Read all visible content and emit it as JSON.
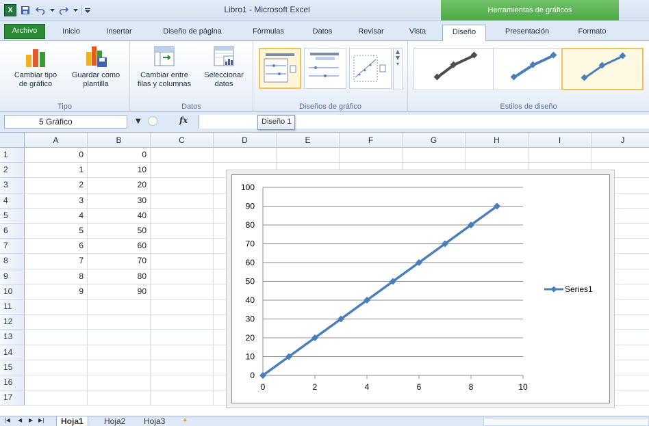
{
  "window": {
    "title": "Libro1 - Microsoft Excel",
    "contextual_header": "Herramientas de gráficos",
    "app_logo": "X"
  },
  "tabs": [
    "Archivo",
    "Inicio",
    "Insertar",
    "Diseño de página",
    "Fórmulas",
    "Datos",
    "Revisar",
    "Vista",
    "Diseño",
    "Presentación",
    "Formato"
  ],
  "active_tab": "Diseño",
  "ribbon": {
    "tipo": {
      "label": "Tipo",
      "change_type": [
        "Cambiar tipo",
        "de gráfico"
      ],
      "save_template": [
        "Guardar como",
        "plantilla"
      ]
    },
    "datos": {
      "label": "Datos",
      "switch": [
        "Cambiar entre",
        "filas y columnas"
      ],
      "select": [
        "Seleccionar",
        "datos"
      ]
    },
    "layouts": {
      "label": "Diseños de gráfico"
    },
    "styles": {
      "label": "Estilos de diseño"
    }
  },
  "formula_bar": {
    "name_box": "5 Gráfico",
    "fx": "fx",
    "value": ""
  },
  "tooltip": "Diseño 1",
  "sheet": {
    "columns": [
      "A",
      "B",
      "C",
      "D",
      "E",
      "F",
      "G",
      "H",
      "I",
      "J"
    ],
    "rows": [
      "1",
      "2",
      "3",
      "4",
      "5",
      "6",
      "7",
      "8",
      "9",
      "10",
      "11",
      "12",
      "13",
      "14",
      "15",
      "16",
      "17"
    ],
    "colA": [
      "0",
      "1",
      "2",
      "3",
      "4",
      "5",
      "6",
      "7",
      "8",
      "9"
    ],
    "colB": [
      "0",
      "10",
      "20",
      "30",
      "40",
      "50",
      "60",
      "70",
      "80",
      "90"
    ]
  },
  "sheet_tabs": [
    "Hoja1",
    "Hoja2",
    "Hoja3"
  ],
  "active_sheet": "Hoja1",
  "colors": {
    "series": "#4a7ebb",
    "file_tab": "#2a8a35",
    "contextual": "#4da845",
    "selection": "#f2c25a"
  },
  "chart_data": {
    "type": "scatter",
    "series": [
      {
        "name": "Series1",
        "x": [
          0,
          1,
          2,
          3,
          4,
          5,
          6,
          7,
          8,
          9
        ],
        "y": [
          0,
          10,
          20,
          30,
          40,
          50,
          60,
          70,
          80,
          90
        ]
      }
    ],
    "xticks": [
      "0",
      "2",
      "4",
      "6",
      "8",
      "10"
    ],
    "yticks": [
      "0",
      "10",
      "20",
      "30",
      "40",
      "50",
      "60",
      "70",
      "80",
      "90",
      "100"
    ],
    "xlim": [
      0,
      10
    ],
    "ylim": [
      0,
      100
    ],
    "grid": "horizontal",
    "legend": "right"
  }
}
